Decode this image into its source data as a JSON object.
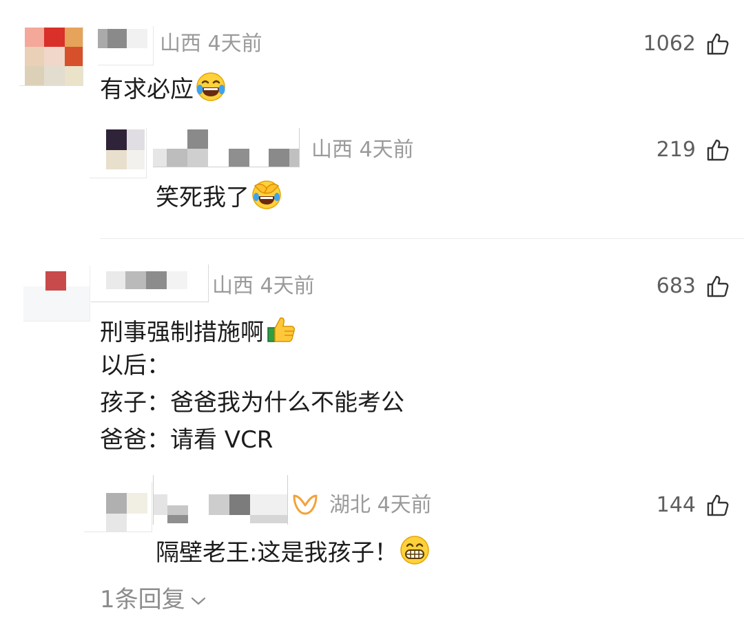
{
  "comments": [
    {
      "location_time": "山西 4天前",
      "likes": "1062",
      "text": "有求必应",
      "emoji": "laughing-tears-emoji",
      "reply": {
        "location_time": "山西 4天前",
        "likes": "219",
        "text": "笑死我了",
        "emoji": "facepalm-laugh-emoji"
      }
    },
    {
      "location_time": "山西 4天前",
      "likes": "683",
      "lines": [
        "刑事强制措施啊",
        "以后：",
        "孩子：爸爸我为什么不能考公",
        "爸爸：请看 VCR"
      ],
      "emoji": "thumbs-up-emoji",
      "reply": {
        "location_time": "湖北 4天前",
        "likes": "144",
        "text": "隔壁老王:这是我孩子！",
        "emoji": "grinning-emoji",
        "badge_icon": "vip-badge-icon"
      },
      "more_replies": "1条回复"
    }
  ],
  "colors": {
    "meta": "#9a9a9a",
    "count": "#5e5e5e",
    "text": "#1c1c1c",
    "badge": "#f2a23a"
  }
}
